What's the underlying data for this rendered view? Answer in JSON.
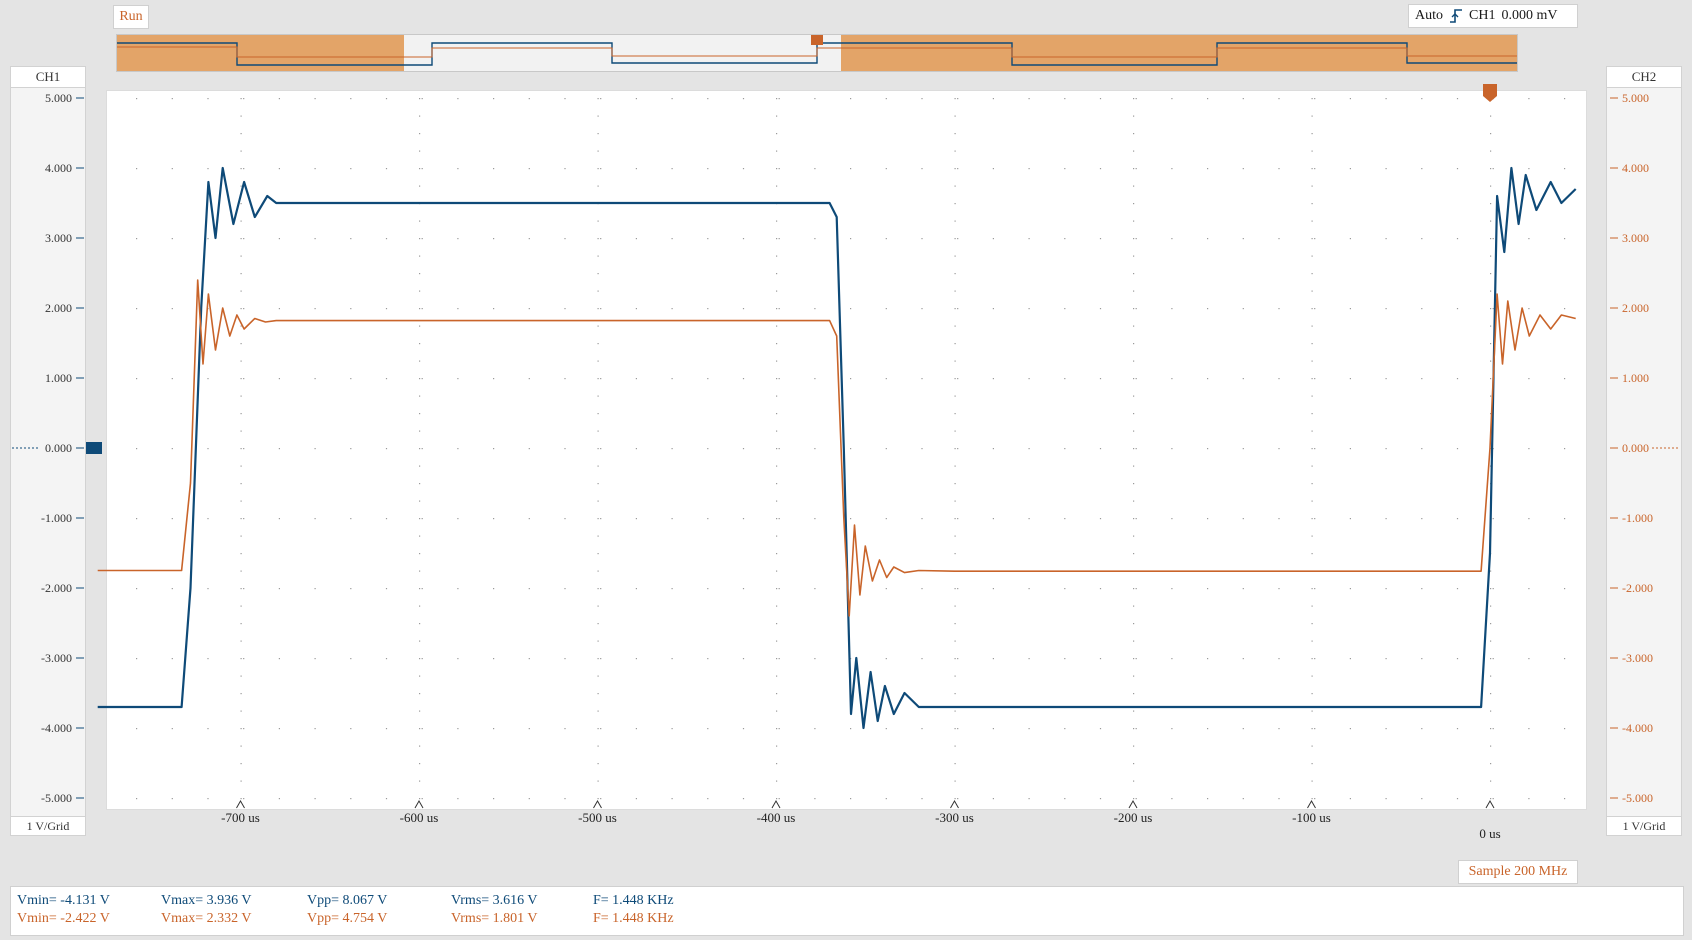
{
  "status": {
    "run_label": "Run"
  },
  "trigger": {
    "mode": "Auto",
    "channel": "CH1",
    "level": "0.000 mV",
    "icon": "rising-edge-icon"
  },
  "channels": {
    "ch1": {
      "title": "CH1",
      "scale": "1 V/Grid",
      "color": "#0e4a78"
    },
    "ch2": {
      "title": "CH2",
      "scale": "1 V/Grid",
      "color": "#c9642a"
    }
  },
  "y_ticks": [
    "5.000",
    "4.000",
    "3.000",
    "2.000",
    "1.000",
    "0.000",
    "-1.000",
    "-2.000",
    "-3.000",
    "-4.000",
    "-5.000"
  ],
  "x_ticks": [
    "-700 us",
    "-600 us",
    "-500 us",
    "-400 us",
    "-300 us",
    "-200 us",
    "-100 us",
    "0 us"
  ],
  "sample_rate": "Sample 200 MHz",
  "measurements": {
    "ch1": {
      "vmin": "Vmin= -4.131 V",
      "vmax": "Vmax= 3.936 V",
      "vpp": "Vpp= 8.067 V",
      "vrms": "Vrms= 3.616 V",
      "freq": "F= 1.448 KHz"
    },
    "ch2": {
      "vmin": "Vmin= -2.422 V",
      "vmax": "Vmax= 2.332 V",
      "vpp": "Vpp= 4.754 V",
      "vrms": "Vrms= 1.801 V",
      "freq": "F= 1.448 KHz"
    }
  },
  "chart_data": {
    "type": "line",
    "x_unit": "us",
    "xlim": [
      -780,
      50
    ],
    "ylim": [
      -5,
      5
    ],
    "series": [
      {
        "name": "CH1",
        "color": "#0e4a78",
        "x": [
          -780,
          -733,
          -728,
          -722,
          -718,
          -714,
          -710,
          -704,
          -698,
          -692,
          -685,
          -680,
          -370,
          -366,
          -362,
          -358,
          -355,
          -351,
          -347,
          -343,
          -339,
          -334,
          -328,
          -320,
          -300,
          -5,
          0,
          4,
          8,
          12,
          16,
          20,
          26,
          34,
          40,
          48
        ],
        "y": [
          -3.7,
          -3.7,
          -2.0,
          2.0,
          3.8,
          3.0,
          4.0,
          3.2,
          3.8,
          3.3,
          3.6,
          3.5,
          3.5,
          3.3,
          0.0,
          -3.8,
          -3.0,
          -4.0,
          -3.2,
          -3.9,
          -3.4,
          -3.8,
          -3.5,
          -3.7,
          -3.7,
          -3.7,
          -1.5,
          3.6,
          2.8,
          4.0,
          3.2,
          3.9,
          3.4,
          3.8,
          3.5,
          3.7
        ]
      },
      {
        "name": "CH2",
        "color": "#c9642a",
        "x": [
          -780,
          -733,
          -728,
          -724,
          -721,
          -718,
          -714,
          -710,
          -706,
          -702,
          -698,
          -692,
          -686,
          -680,
          -370,
          -366,
          -362,
          -359,
          -356,
          -353,
          -350,
          -346,
          -342,
          -338,
          -334,
          -328,
          -320,
          -300,
          -5,
          0,
          4,
          7,
          10,
          14,
          18,
          22,
          28,
          34,
          40,
          48
        ],
        "y": [
          -1.75,
          -1.75,
          -0.5,
          2.4,
          1.2,
          2.2,
          1.4,
          2.0,
          1.6,
          1.9,
          1.7,
          1.85,
          1.8,
          1.82,
          1.82,
          1.6,
          -1.0,
          -2.4,
          -1.1,
          -2.1,
          -1.4,
          -1.9,
          -1.6,
          -1.85,
          -1.7,
          -1.78,
          -1.75,
          -1.76,
          -1.76,
          0.0,
          2.2,
          1.2,
          2.1,
          1.4,
          2.0,
          1.6,
          1.9,
          1.7,
          1.9,
          1.85
        ]
      }
    ]
  }
}
